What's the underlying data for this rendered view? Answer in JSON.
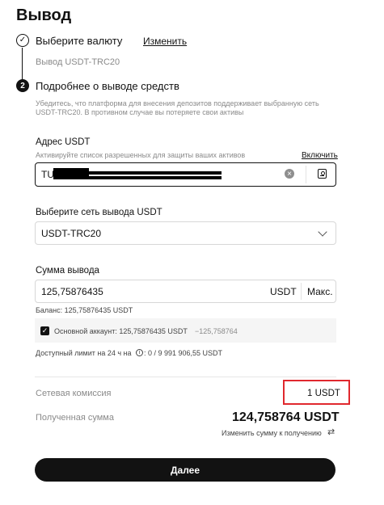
{
  "page": {
    "title": "Вывод"
  },
  "step1": {
    "title": "Выберите валюту",
    "change_link": "Изменить",
    "summary": "Вывод USDT-TRC20",
    "check_glyph": "✓"
  },
  "step2": {
    "number": "2",
    "title": "Подробнее о выводе средств",
    "warning_line1": "Убедитесь, что платформа для внесения депозитов поддерживает выбранную сеть",
    "warning_line2": "USDT-TRC20. В противном случае вы потеряете свои активы"
  },
  "address": {
    "label": "Адрес USDT",
    "hint": "Активируйте список разрешенных для защиты ваших активов",
    "enable_link": "Включить",
    "value_prefix": "TU",
    "clear_glyph": "×"
  },
  "network": {
    "label": "Выберите сеть вывода USDT",
    "selected": "USDT-TRC20"
  },
  "amount": {
    "label": "Сумма вывода",
    "value": "125,75876435",
    "currency": "USDT",
    "max_label": "Макс.",
    "balance": "Баланс: 125,75876435 USDT",
    "account_label": "Основной аккаунт: 125,75876435 USDT",
    "account_delta": "−125,758764",
    "limit_prefix": "Доступный лимит на 24 ч на",
    "limit_suffix": ": 0 / 9 991 906,55 USDT",
    "info_glyph": "i"
  },
  "summary": {
    "fee_label": "Сетевая комиссия",
    "fee_value": "1 USDT",
    "received_label": "Полученная сумма",
    "received_value": "124,758764 USDT",
    "change_receive_link": "Изменить сумму к получению",
    "swap_glyph": "⇄"
  },
  "submit": {
    "label": "Далее"
  },
  "colors": {
    "highlight": "#e0282e",
    "primary": "#121212",
    "muted": "#8a8a8a"
  }
}
